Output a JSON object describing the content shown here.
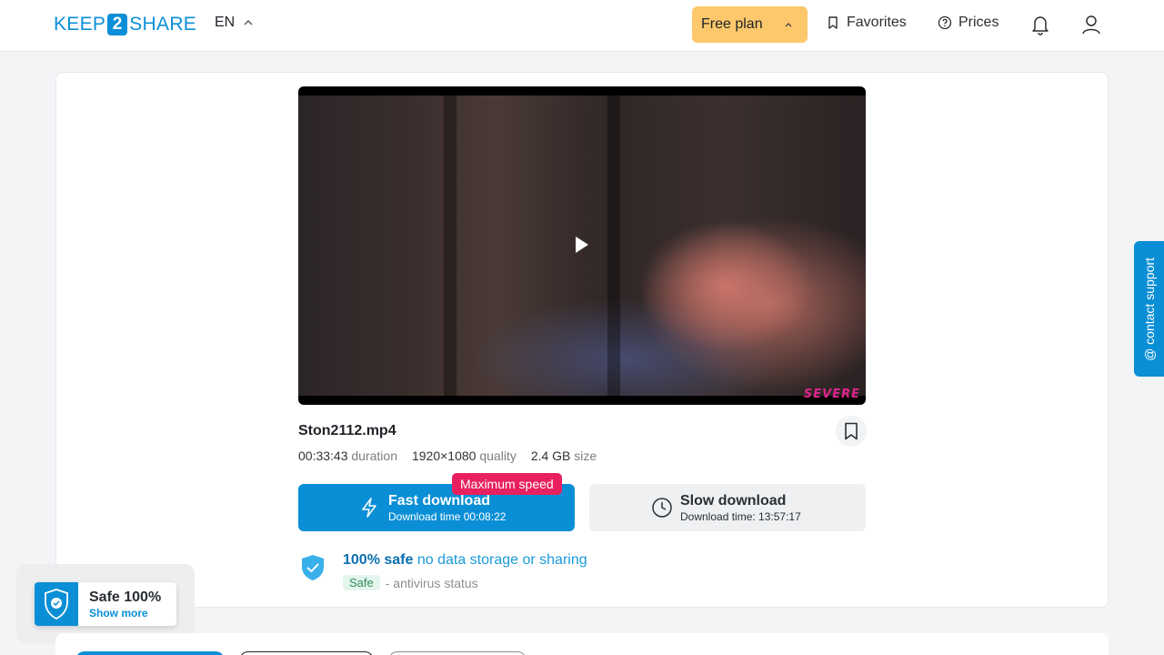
{
  "header": {
    "logo": {
      "prefix": "KEEP",
      "digit": "2",
      "suffix": "SHARE"
    },
    "language": "EN",
    "plan_label": "Free plan",
    "favorites_label": "Favorites",
    "prices_label": "Prices"
  },
  "file": {
    "name": "Ston2112.mp4",
    "duration_value": "00:33:43",
    "duration_label": "duration",
    "quality_value": "1920×1080",
    "quality_label": "quality",
    "size_value": "2.4 GB",
    "size_label": "size",
    "video_watermark": "SEVERE"
  },
  "download": {
    "max_speed_badge": "Maximum speed",
    "fast_title": "Fast download",
    "fast_time": "Download time 00:08:22",
    "slow_title": "Slow download",
    "slow_time": "Download time: 13:57:17"
  },
  "safety": {
    "strong": "100% safe",
    "rest": "no data storage or sharing",
    "status_pill": "Safe",
    "status_label": "- antivirus status"
  },
  "support_label": "@ contact support",
  "toast": {
    "title": "Safe 100%",
    "link": "Show more"
  },
  "colors": {
    "brand": "#0a8fd6",
    "plan": "#fcc86b",
    "badge": "#e8205f"
  }
}
